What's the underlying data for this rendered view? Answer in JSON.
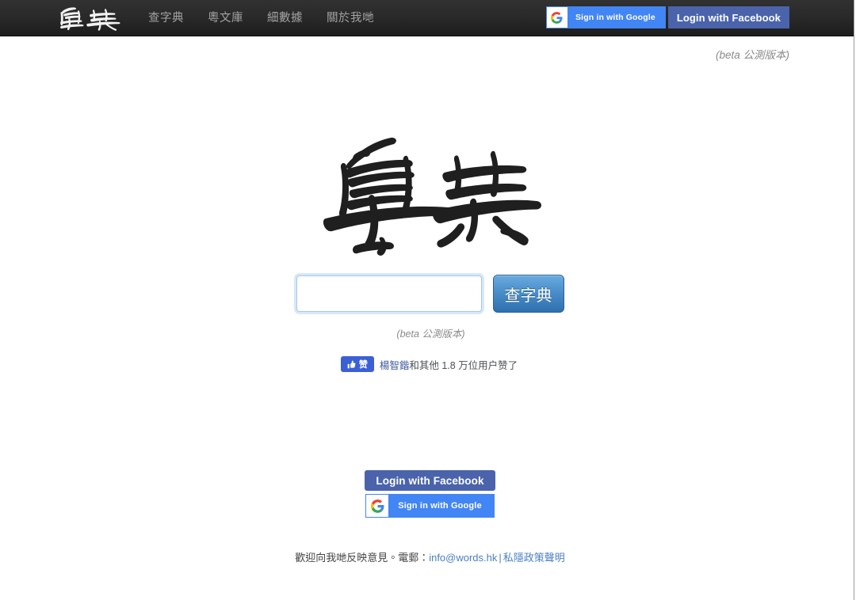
{
  "navbar": {
    "brand_label": "粵典",
    "links": [
      {
        "label": "查字典",
        "name": "nav-link-dictionary"
      },
      {
        "label": "粵文庫",
        "name": "nav-link-library"
      },
      {
        "label": "細數據",
        "name": "nav-link-data"
      },
      {
        "label": "關於我哋",
        "name": "nav-link-about"
      }
    ],
    "google_button": "Sign in with Google",
    "facebook_button": "Login with Facebook"
  },
  "beta_notice_top": "(beta 公測版本)",
  "hero": {
    "logo_label": "粵典",
    "search_value": "",
    "search_placeholder": "",
    "search_button": "查字典",
    "beta_notice": "(beta 公測版本)"
  },
  "facebook_like": {
    "button_label": "赞",
    "liker_name": "楊智鍇",
    "text_after": "和其他 1.8 万位用户赞了"
  },
  "bottom_auth": {
    "facebook_button": "Login with Facebook",
    "google_button": "Sign in with Google"
  },
  "footer": {
    "intro": "歡迎向我哋反映意見。電郵：",
    "email": "info@words.hk",
    "separator": "|",
    "privacy": "私隱政策聲明"
  },
  "colors": {
    "navbar_top": "#313131",
    "navbar_bottom": "#1d1d1d",
    "google_blue": "#4285f4",
    "facebook_blue": "#4a63ab",
    "like_blue": "#3b5fd4",
    "link_blue": "#4a7fc1",
    "search_button_blue": "#2f6fae",
    "nav_link_gray": "#a3a3a3",
    "beta_gray": "#8a8a8a"
  }
}
